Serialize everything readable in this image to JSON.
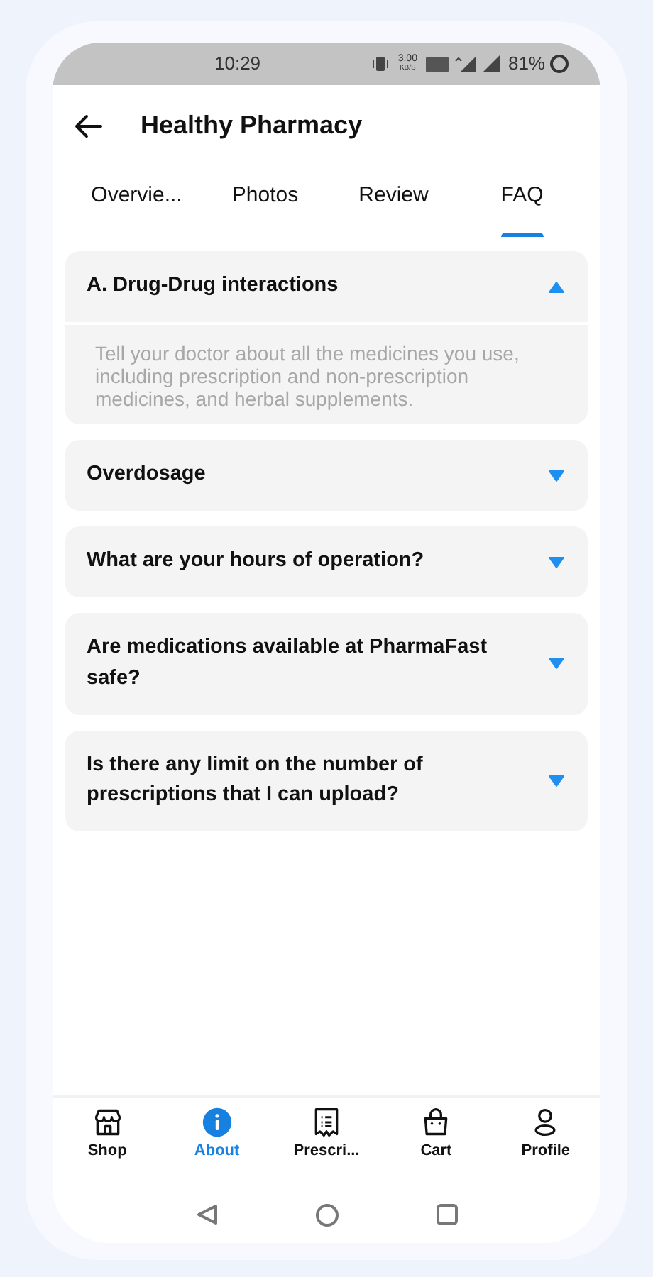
{
  "status_bar": {
    "time": "10:29",
    "speed_value": "3.00",
    "speed_unit": "KB/S",
    "battery": "81%"
  },
  "header": {
    "title": "Healthy Pharmacy"
  },
  "tabs": [
    {
      "label": "Overvie...",
      "selected": false
    },
    {
      "label": "Photos",
      "selected": false
    },
    {
      "label": "Review",
      "selected": false
    },
    {
      "label": "FAQ",
      "selected": true
    }
  ],
  "faq": [
    {
      "question": "A. Drug-Drug interactions",
      "expanded": true,
      "answer": "Tell your doctor about all the medicines you use, including prescription and non-prescription medicines, and herbal supplements."
    },
    {
      "question": "Overdosage",
      "expanded": false
    },
    {
      "question": "What are your hours of operation?",
      "expanded": false
    },
    {
      "question": "Are medications available at PharmaFast safe?",
      "expanded": false
    },
    {
      "question": "Is there any limit on the number of prescriptions that I can upload?",
      "expanded": false
    }
  ],
  "bottom_nav": [
    {
      "kind": "shop",
      "label": "Shop",
      "selected": false
    },
    {
      "kind": "about",
      "label": "About",
      "selected": true
    },
    {
      "kind": "prescription",
      "label": "Prescri...",
      "selected": false
    },
    {
      "kind": "cart",
      "label": "Cart",
      "selected": false
    },
    {
      "kind": "profile",
      "label": "Profile",
      "selected": false
    }
  ]
}
